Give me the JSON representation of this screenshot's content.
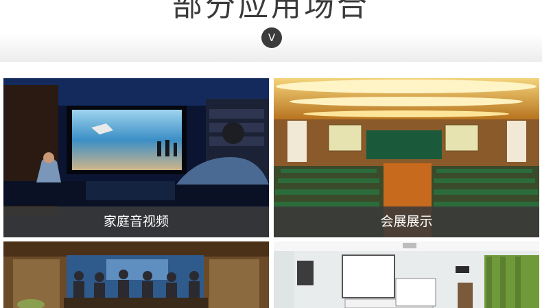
{
  "header": {
    "title": "部分应用场合",
    "toggle_label": "V"
  },
  "scenes": [
    {
      "caption": "家庭音视频",
      "icon": "home-theater-image"
    },
    {
      "caption": "会展展示",
      "icon": "conference-hall-image"
    },
    {
      "caption": "",
      "icon": "video-conference-image"
    },
    {
      "caption": "",
      "icon": "classroom-projector-image"
    }
  ]
}
